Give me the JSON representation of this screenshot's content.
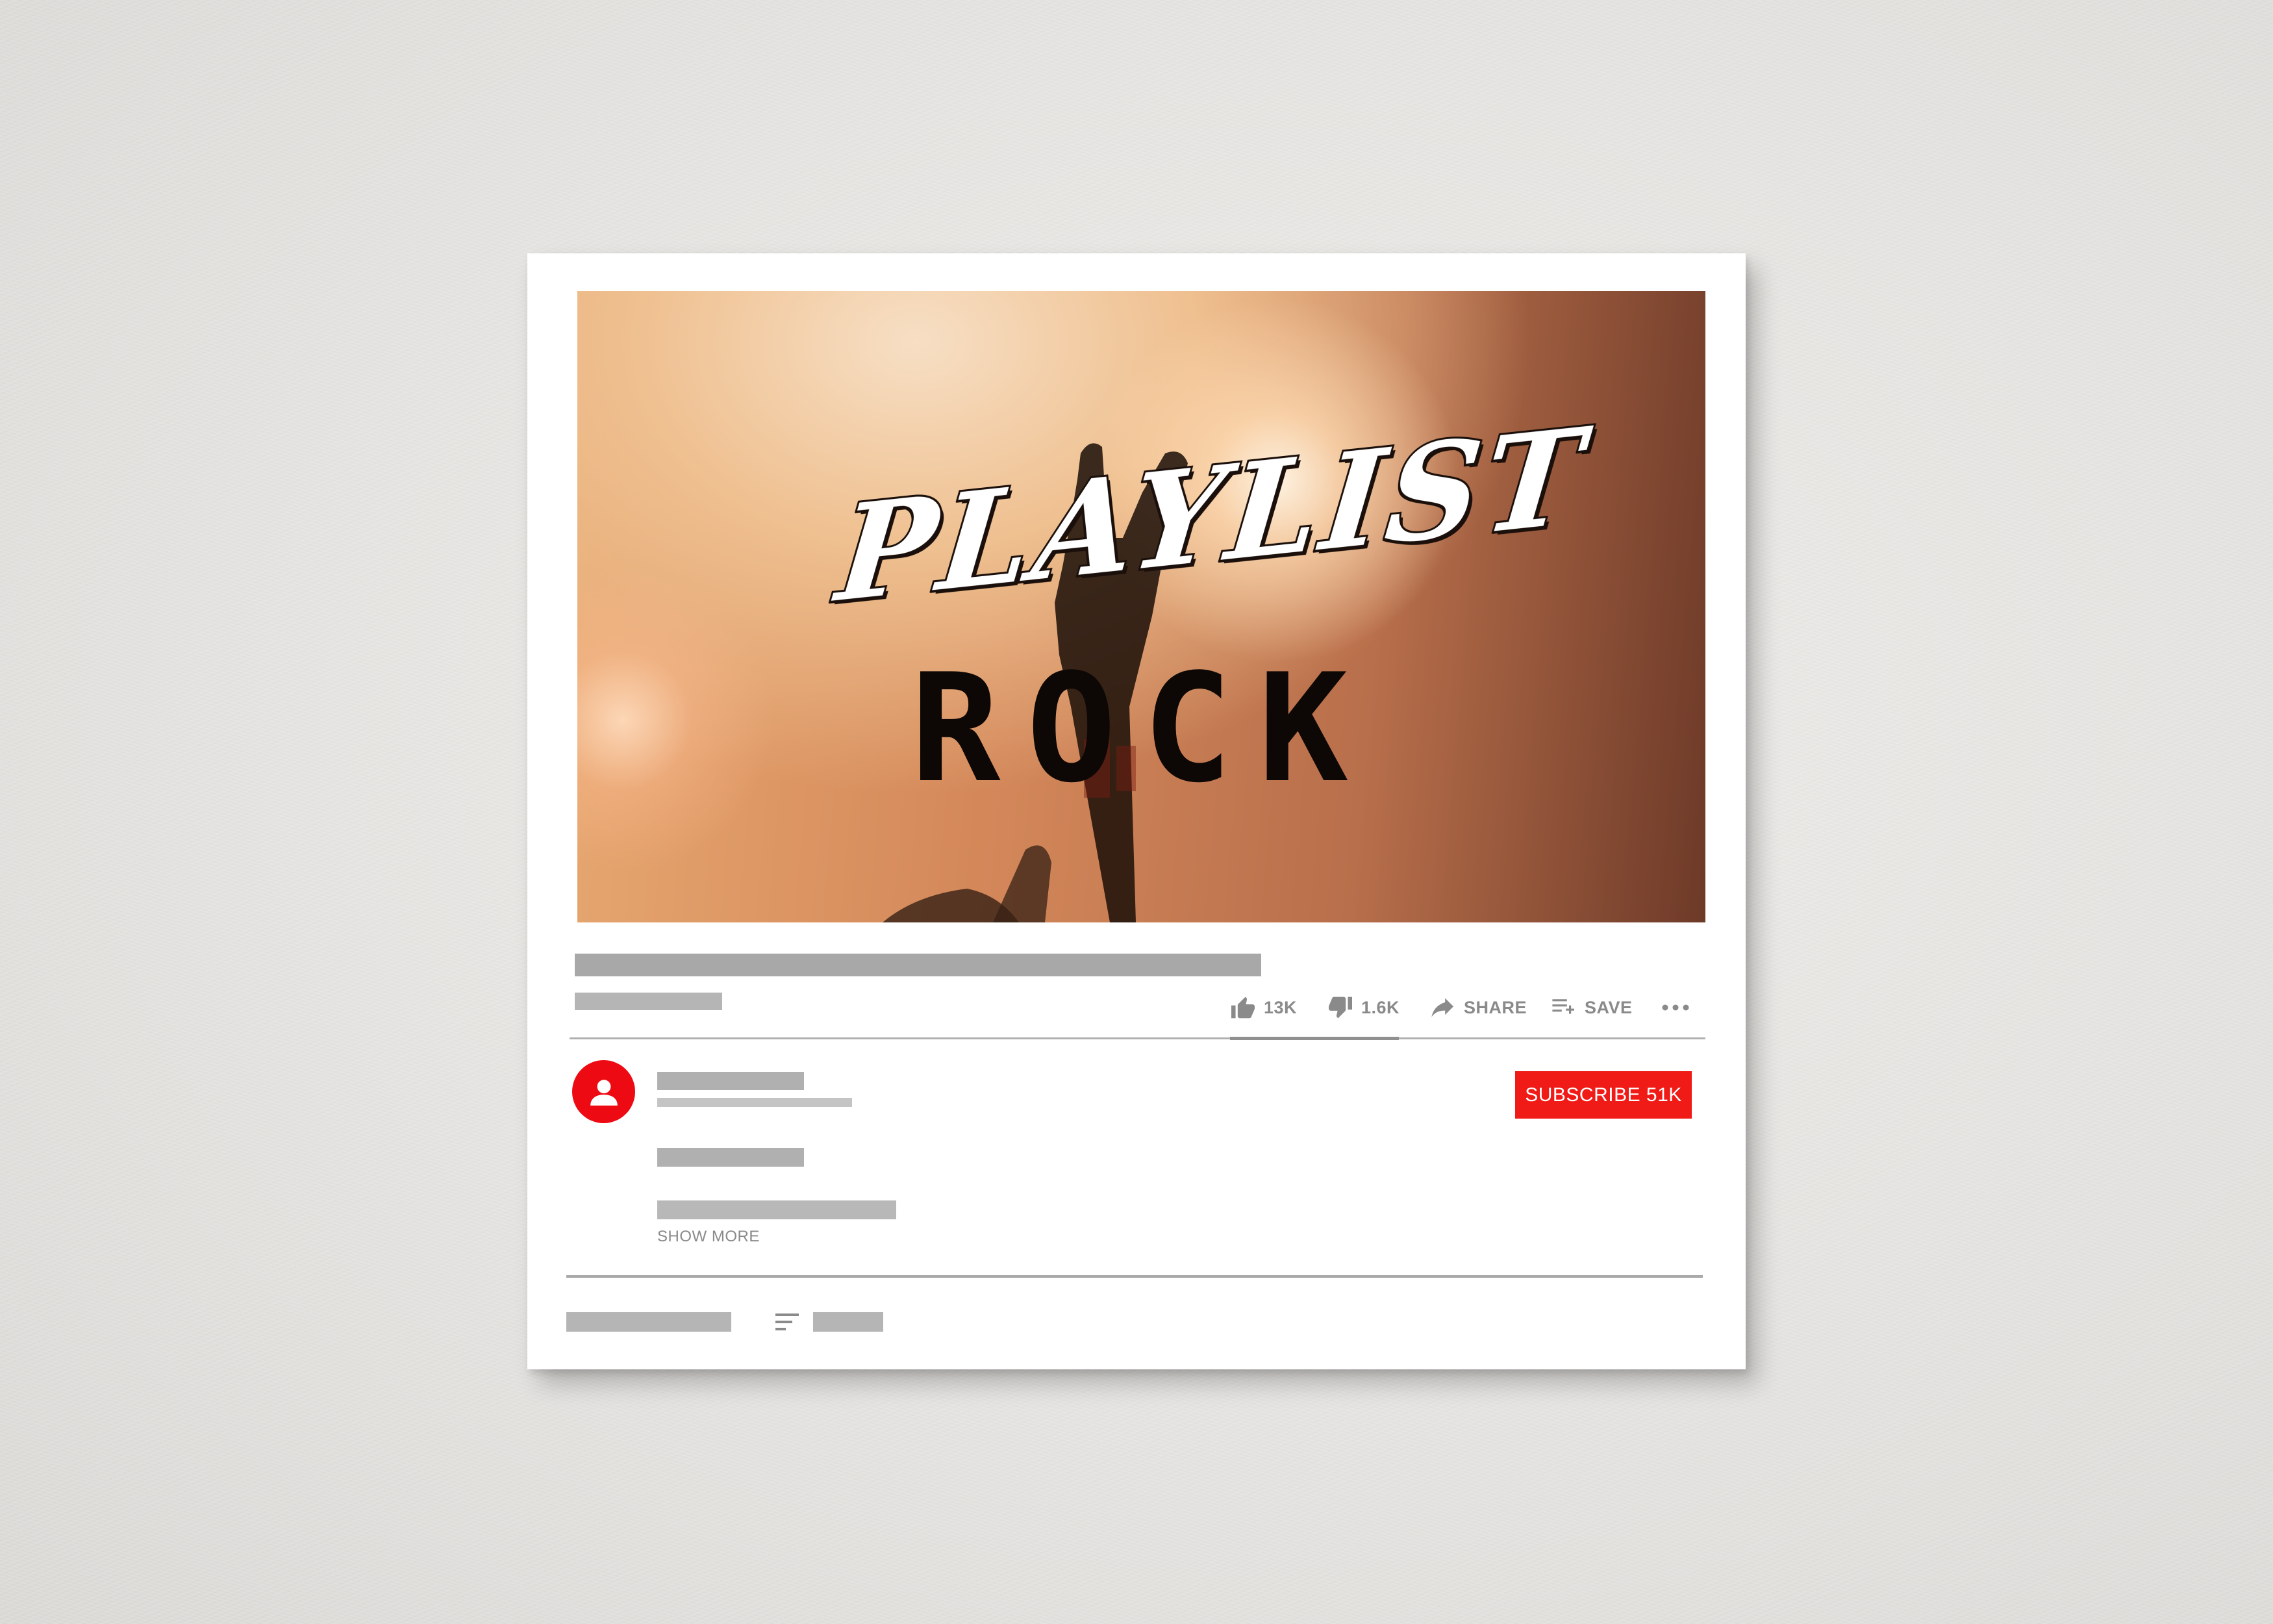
{
  "thumbnail": {
    "title_line_1": "PLAYLIST",
    "title_line_2": "ROCK"
  },
  "actions": {
    "like_count": "13K",
    "dislike_count": "1.6K",
    "share_label": "SHARE",
    "save_label": "SAVE",
    "like_ratio": 0.89
  },
  "channel": {
    "subscribe_label": "SUBSCRIBE 51K"
  },
  "description": {
    "show_more_label": "SHOW MORE"
  },
  "icons": {
    "like": "thumbs-up-icon",
    "dislike": "thumbs-down-icon",
    "share": "share-arrow-icon",
    "save": "playlist-add-icon",
    "more": "more-horizontal-icon",
    "avatar": "user-avatar-icon",
    "sort": "sort-icon"
  },
  "colors": {
    "brand_red": "#f01b16",
    "placeholder_gray": "#b0b0b0",
    "action_gray": "#8a8a8a"
  }
}
